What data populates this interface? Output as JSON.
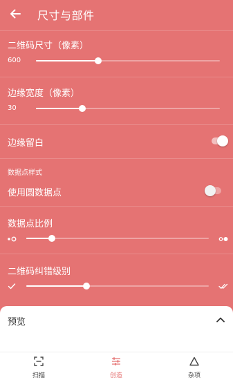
{
  "header": {
    "title": "尺寸与部件",
    "back_icon": "arrow-left-icon"
  },
  "qr_size": {
    "label": "二维码尺寸（像素）",
    "value_text": "600",
    "fraction": 0.34
  },
  "margin_width": {
    "label": "边缘宽度（像素）",
    "value_text": "30",
    "fraction": 0.25
  },
  "margin_blank": {
    "label": "边缘留白",
    "enabled": true
  },
  "dot_style": {
    "section_label": "数据点样式",
    "round_dots_label": "使用圆数据点",
    "round_dots_enabled": false
  },
  "dot_ratio": {
    "label": "数据点比例",
    "fraction": 0.14,
    "icon_left": "dot-small-icon",
    "icon_right": "dot-large-icon"
  },
  "error_correction": {
    "label": "二维码纠错级别",
    "fraction": 0.33,
    "icon_left": "check-icon",
    "icon_right": "double-check-icon"
  },
  "preview": {
    "title": "预览",
    "icon": "chevron-up-icon"
  },
  "nav": {
    "items": [
      {
        "label": "扫描",
        "icon": "scan-icon",
        "active": false
      },
      {
        "label": "创造",
        "icon": "sliders-icon",
        "active": true
      },
      {
        "label": "杂项",
        "icon": "triangle-icon",
        "active": false
      }
    ]
  },
  "colors": {
    "background": "#e57373",
    "accent": "#e57373",
    "sheet": "#ffffff"
  }
}
